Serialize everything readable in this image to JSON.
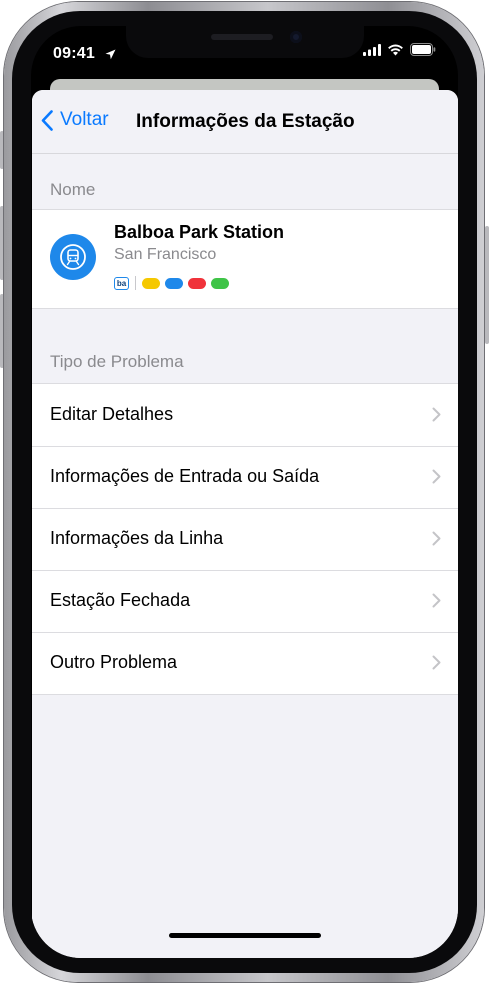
{
  "status": {
    "time": "09:41"
  },
  "nav": {
    "back_label": "Voltar",
    "title": "Informações da Estação"
  },
  "sections": {
    "name_header": "Nome",
    "problem_header": "Tipo de Problema"
  },
  "station": {
    "name": "Balboa Park Station",
    "city": "San Francisco",
    "agency_badge": "ba",
    "line_colors": [
      "#f5c800",
      "#1e88ea",
      "#f0323a",
      "#3fc447"
    ]
  },
  "problem_types": [
    {
      "label": "Editar Detalhes"
    },
    {
      "label": "Informações de Entrada ou Saída"
    },
    {
      "label": "Informações da Linha"
    },
    {
      "label": "Estação Fechada"
    },
    {
      "label": "Outro Problema"
    }
  ],
  "colors": {
    "accent": "#0a7aff",
    "station_icon_bg": "#1e88ea",
    "grouped_bg": "#f2f2f7"
  }
}
